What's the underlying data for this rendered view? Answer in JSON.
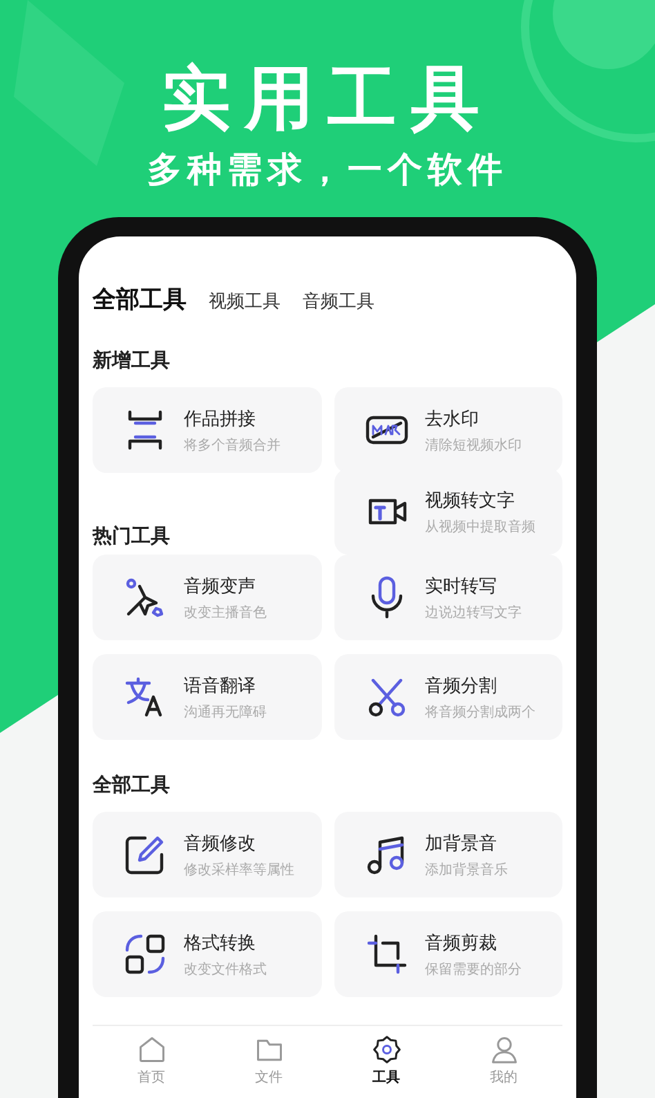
{
  "headline": "实用工具",
  "subheadline": "多种需求，一个软件",
  "tabs": [
    {
      "label": "全部工具",
      "selected": true
    },
    {
      "label": "视频工具",
      "selected": false
    },
    {
      "label": "音频工具",
      "selected": false
    }
  ],
  "sections": [
    {
      "title": "新增工具",
      "tools": [
        {
          "name": "作品拼接",
          "desc": "将多个音频合并"
        },
        {
          "name": "去水印",
          "desc": "清除短视频水印"
        },
        {
          "name": "视频转文字",
          "desc": "从视频中提取音频"
        }
      ]
    },
    {
      "title": "热门工具",
      "tools": [
        {
          "name": "音频变声",
          "desc": "改变主播音色"
        },
        {
          "name": "实时转写",
          "desc": "边说边转写文字"
        },
        {
          "name": "语音翻译",
          "desc": "沟通再无障碍"
        },
        {
          "name": "音频分割",
          "desc": "将音频分割成两个"
        }
      ]
    },
    {
      "title": "全部工具",
      "tools": [
        {
          "name": "音频修改",
          "desc": "修改采样率等属性"
        },
        {
          "name": "加背景音",
          "desc": "添加背景音乐"
        },
        {
          "name": "格式转换",
          "desc": "改变文件格式"
        },
        {
          "name": "音频剪裁",
          "desc": "保留需要的部分"
        }
      ]
    }
  ],
  "nav": [
    {
      "label": "首页",
      "selected": false
    },
    {
      "label": "文件",
      "selected": false
    },
    {
      "label": "工具",
      "selected": true
    },
    {
      "label": "我的",
      "selected": false
    }
  ]
}
